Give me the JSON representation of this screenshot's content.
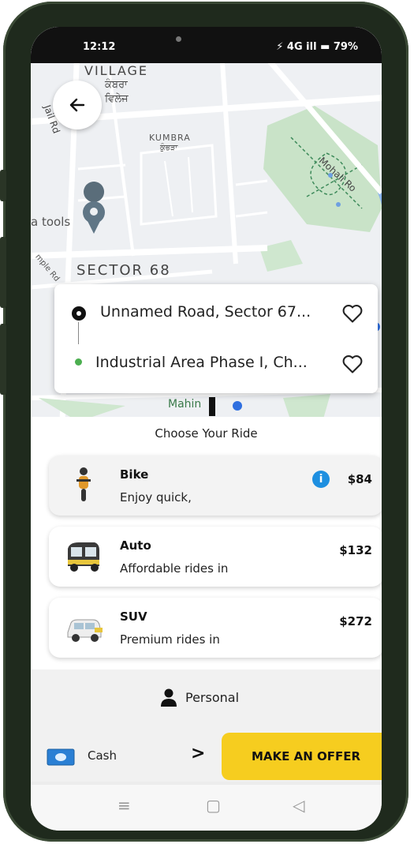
{
  "status_bar": {
    "time": "12:12",
    "right": "⚡ 4G ill ▬ 79%"
  },
  "map": {
    "labels": {
      "village": "VILLAGE",
      "village_pa1": "ਕੰਬਰਾ",
      "village_pa2": "ਵਿਲੇਜ",
      "kumbra": "KUMBRA",
      "kumbra_pa": "ਕੁੰਭੜਾ",
      "jail_rd": "Jail Rd",
      "tools": "a tools",
      "mohali": "Mohali Ro",
      "sector": "SECTOR 68",
      "temple_rd": "mple Rd",
      "mahin": "Mahin"
    }
  },
  "locations": {
    "pickup": "Unnamed Road, Sector 67...",
    "drop": "Industrial Area Phase I, Ch..."
  },
  "ride_section": {
    "title": "Choose Your Ride"
  },
  "rides": [
    {
      "name": "Bike",
      "desc": "Enjoy quick,",
      "price": "$84",
      "icon": "bike-icon"
    },
    {
      "name": "Auto",
      "desc": "Affordable rides in",
      "price": "$132",
      "icon": "auto-rickshaw-icon"
    },
    {
      "name": "SUV",
      "desc": "Premium rides in",
      "price": "$272",
      "icon": "suv-icon"
    }
  ],
  "profile": {
    "label": "Personal"
  },
  "payment": {
    "method": "Cash"
  },
  "actions": {
    "offer": "MAKE AN OFFER"
  },
  "nav": {
    "menu": "≡",
    "home": "▢",
    "back": "◁"
  },
  "colors": {
    "accent": "#f6cd1f",
    "info": "#1e8fe0",
    "drop_dot": "#4caf50"
  }
}
